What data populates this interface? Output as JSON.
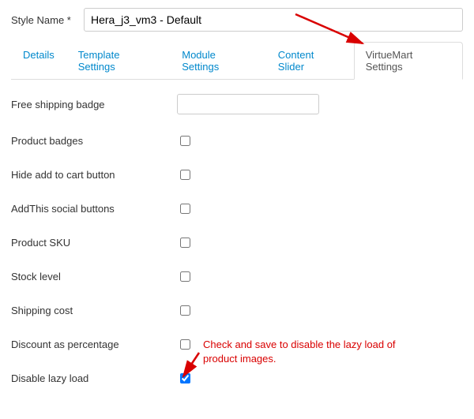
{
  "header": {
    "style_name_label": "Style Name *",
    "style_name_value": "Hera_j3_vm3 - Default"
  },
  "tabs": {
    "details": "Details",
    "template_settings": "Template Settings",
    "module_settings": "Module Settings",
    "content_slider": "Content Slider",
    "virtuemart_settings": "VirtueMart Settings"
  },
  "fields": {
    "free_shipping_badge": {
      "label": "Free shipping badge",
      "value": ""
    },
    "product_badges": {
      "label": "Product badges",
      "checked": false
    },
    "hide_add_to_cart": {
      "label": "Hide add to cart button",
      "checked": false
    },
    "addthis_social": {
      "label": "AddThis social buttons",
      "checked": false
    },
    "product_sku": {
      "label": "Product SKU",
      "checked": false
    },
    "stock_level": {
      "label": "Stock level",
      "checked": false
    },
    "shipping_cost": {
      "label": "Shipping cost",
      "checked": false
    },
    "discount_percentage": {
      "label": "Discount as percentage",
      "checked": false
    },
    "disable_lazy_load": {
      "label": "Disable lazy load",
      "checked": true
    }
  },
  "annotation": {
    "text": "Check and save to disable the lazy load of product images."
  },
  "colors": {
    "link": "#0088cc",
    "annotation": "#d90000",
    "border": "#dddddd"
  }
}
